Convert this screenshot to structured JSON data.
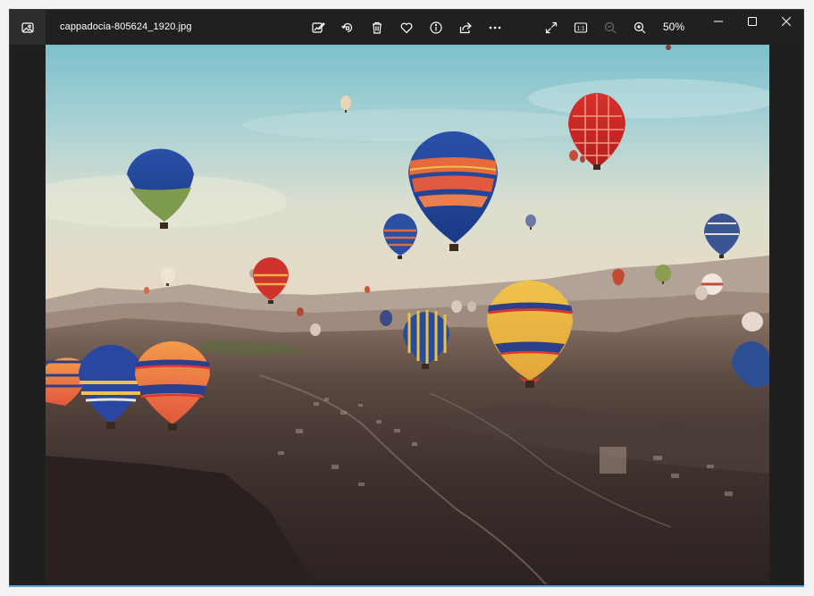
{
  "window": {
    "file_name": "cappadocia-805624_1920.jpg",
    "zoom_level": "50%"
  },
  "toolbar": {
    "app_icon": "photos-app-icon",
    "edit_icon": "edit-image-icon",
    "rotate_icon": "rotate-icon",
    "delete_icon": "trash-icon",
    "favorite_icon": "heart-icon",
    "info_icon": "info-icon",
    "share_icon": "share-icon",
    "more_icon": "more-dots-icon",
    "fullscreen_icon": "expand-icon",
    "actual_size_label": "1:1",
    "zoom_out_icon": "zoom-out-icon",
    "zoom_in_icon": "zoom-in-icon"
  },
  "window_controls": {
    "minimize_icon": "minimize-icon",
    "maximize_icon": "maximize-icon",
    "close_icon": "close-icon"
  },
  "photo": {
    "subject": "hot air balloons over Cappadocia valley",
    "colors": {
      "sky_top": "#7cc0cc",
      "sky_bottom": "#e8e4d0",
      "ground": "#3a2e2c"
    }
  }
}
